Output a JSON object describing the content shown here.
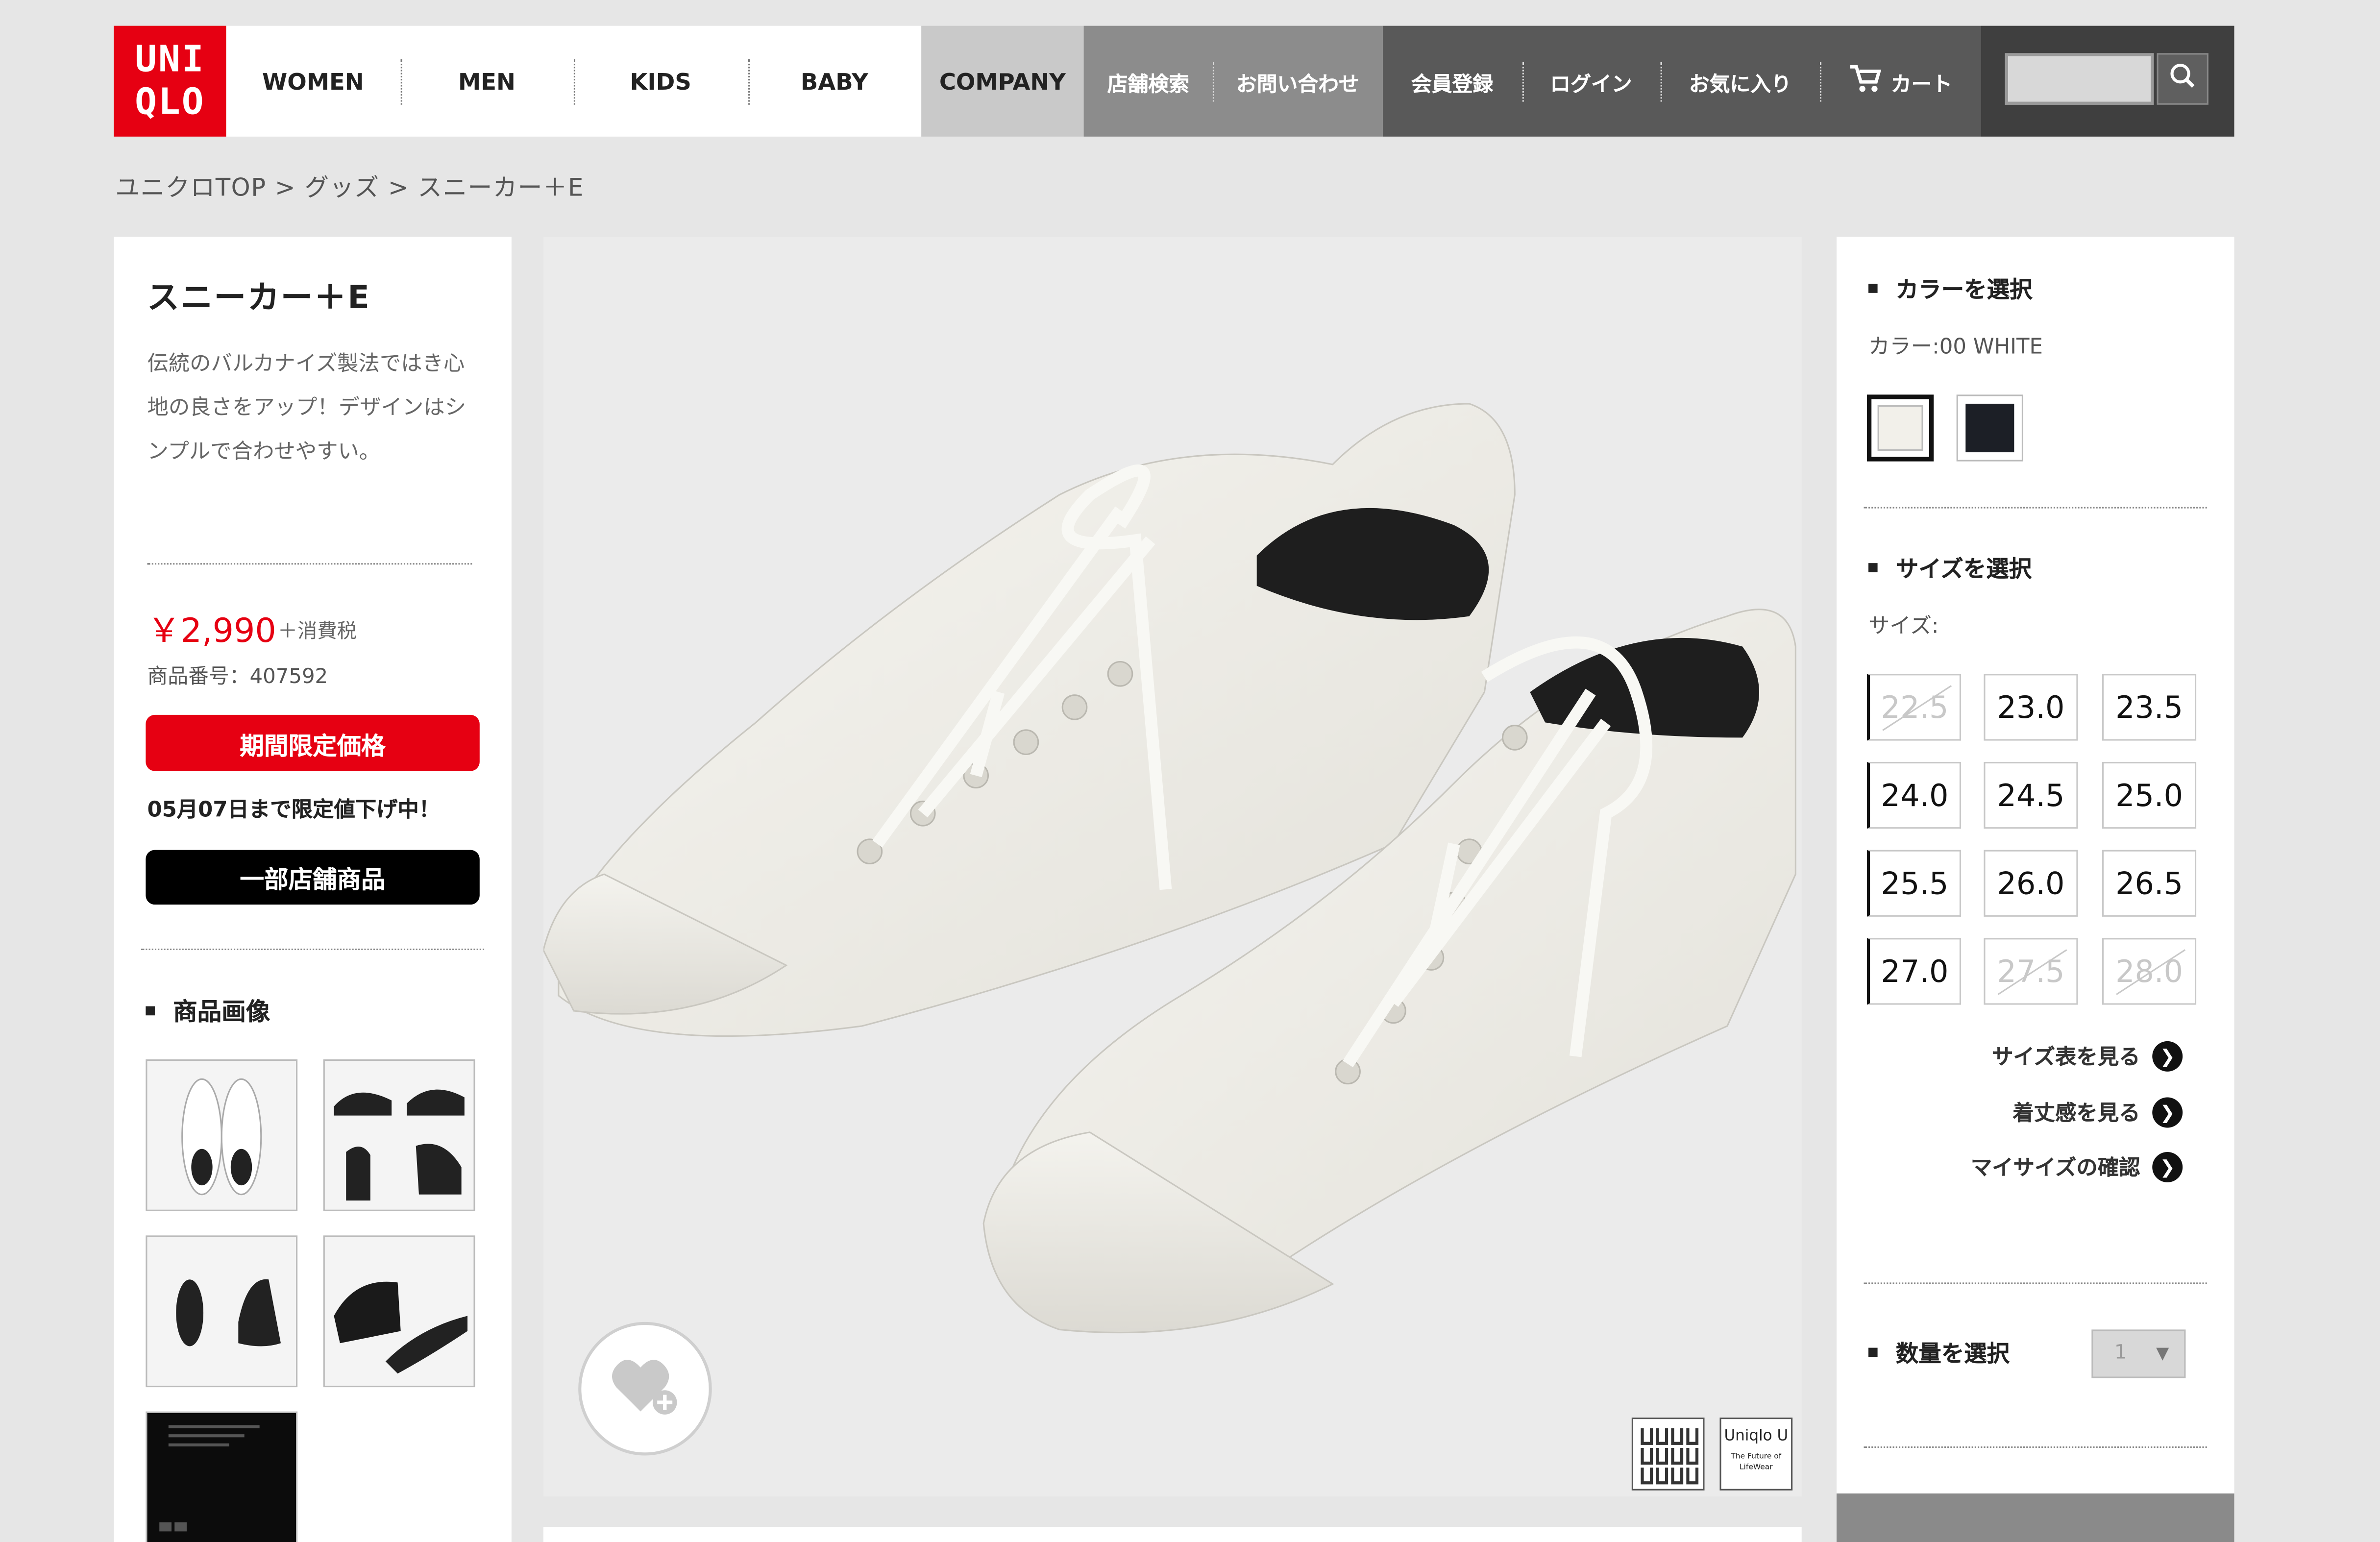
{
  "header": {
    "logo": [
      "UNI",
      "QLO"
    ],
    "nav": [
      "WOMEN",
      "MEN",
      "KIDS",
      "BABY"
    ],
    "company": "COMPANY",
    "nav_mid": [
      "店舗検索",
      "お問い合わせ"
    ],
    "nav_dark": [
      "会員登録",
      "ログイン",
      "お気に入り",
      "カート"
    ],
    "search_placeholder": ""
  },
  "breadcrumb": "ユニクロTOP > グッズ > スニーカー＋E",
  "product": {
    "name": "スニーカー＋E",
    "description": "伝統のバルカナイズ製法ではき心地の良さをアップ！デザインはシンプルで合わせやすい。",
    "price": "￥2,990",
    "tax": "＋消費税",
    "number": "商品番号：407592",
    "badge_sale": "期間限定価格",
    "sale_until": "05月07日まで限定値下げ中！",
    "badge_store": "一部店舗商品",
    "images_heading": "商品画像"
  },
  "color": {
    "heading": "カラーを選択",
    "label": "カラー:00 WHITE",
    "swatches": [
      "#f2f0ea",
      "#1c1f26"
    ]
  },
  "size": {
    "heading": "サイズを選択",
    "label": "サイズ:",
    "options": [
      {
        "v": "22.5",
        "available": false
      },
      {
        "v": "23.0",
        "available": true
      },
      {
        "v": "23.5",
        "available": true
      },
      {
        "v": "24.0",
        "available": true
      },
      {
        "v": "24.5",
        "available": true
      },
      {
        "v": "25.0",
        "available": true
      },
      {
        "v": "25.5",
        "available": true
      },
      {
        "v": "26.0",
        "available": true
      },
      {
        "v": "26.5",
        "available": true
      },
      {
        "v": "27.0",
        "available": true
      },
      {
        "v": "27.5",
        "available": false
      },
      {
        "v": "28.0",
        "available": false
      }
    ],
    "links": [
      "サイズ表を見る",
      "着丈感を見る",
      "マイサイズの確認"
    ]
  },
  "quantity": {
    "heading": "数量を選択",
    "value": "1"
  },
  "badges": {
    "uniqlo_u_title": "Uniqlo U",
    "uniqlo_u_sub": "The Future of LifeWear"
  }
}
